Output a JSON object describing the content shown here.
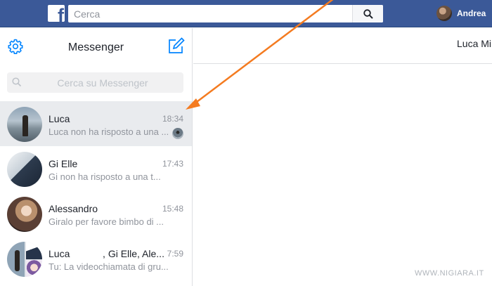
{
  "topbar": {
    "logo_letter": "f",
    "search_placeholder": "Cerca",
    "user_name": "Andrea"
  },
  "messenger": {
    "title": "Messenger",
    "search_placeholder": "Cerca su Messenger",
    "conversations": [
      {
        "name": "Luca",
        "time": "18:34",
        "snippet": "Luca non ha risposto a una ...",
        "active": true
      },
      {
        "name": "Gi Elle",
        "time": "17:43",
        "snippet": "Gi non ha risposto a una t..."
      },
      {
        "name": "Alessandro",
        "time": "15:48",
        "snippet": "Giralo per favore bimbo di ..."
      },
      {
        "name": "Luca            , Gi Elle, Ale...",
        "time": "7:59",
        "snippet": "Tu: La videochiamata di gru..."
      }
    ]
  },
  "chat": {
    "title": "Luca Mi"
  },
  "watermark": "WWW.NIGIARA.IT",
  "colors": {
    "brand": "#3b5998",
    "messenger_blue": "#0084ff",
    "arrow": "#f47b20"
  }
}
